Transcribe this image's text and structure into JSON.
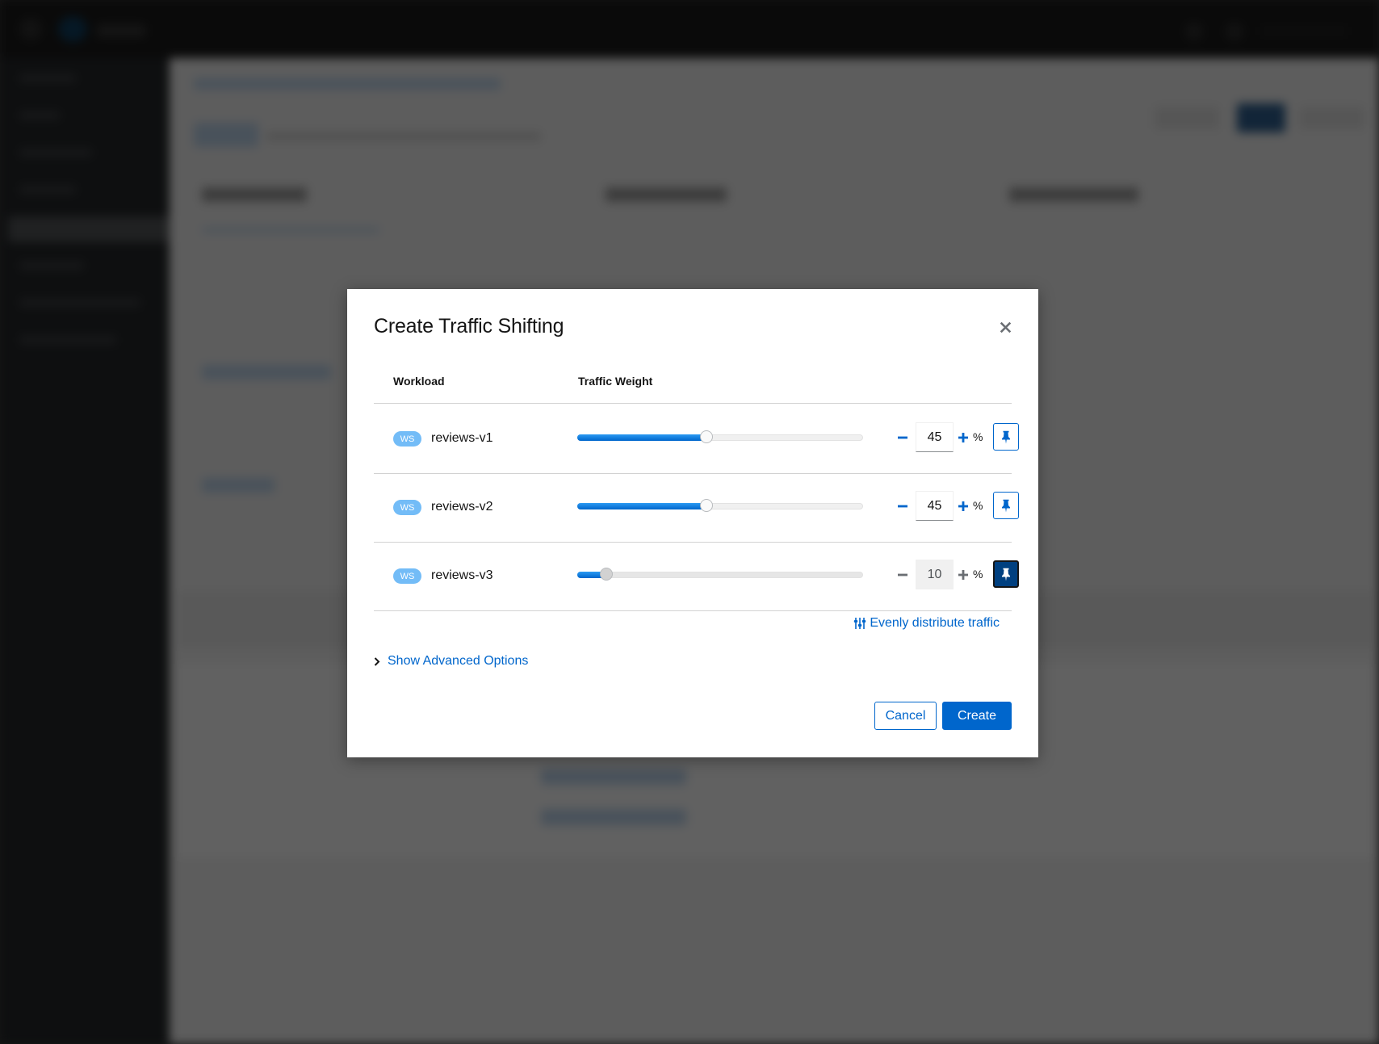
{
  "modal": {
    "title": "Create Traffic Shifting",
    "columns": {
      "workload": "Workload",
      "traffic_weight": "Traffic Weight"
    },
    "rows": [
      {
        "badge": "WS",
        "name": "reviews-v1",
        "weight": 45,
        "weight_text": "45",
        "unit": "%",
        "locked": false
      },
      {
        "badge": "WS",
        "name": "reviews-v2",
        "weight": 45,
        "weight_text": "45",
        "unit": "%",
        "locked": false
      },
      {
        "badge": "WS",
        "name": "reviews-v3",
        "weight": 10,
        "weight_text": "10",
        "unit": "%",
        "locked": true
      }
    ],
    "evenly_distribute_label": "Evenly distribute traffic",
    "advanced_options_label": "Show Advanced Options",
    "cancel_label": "Cancel",
    "create_label": "Create"
  },
  "colors": {
    "primary": "#0066cc",
    "primary_dark": "#004080",
    "badge": "#73bcf7",
    "slider_fill": "#2b9af3"
  },
  "icons": {
    "close": "close-icon",
    "minus": "minus-icon",
    "plus": "plus-icon",
    "pin": "thumbtack-icon",
    "evenly": "sliders-icon",
    "expand": "chevron-right-icon"
  }
}
